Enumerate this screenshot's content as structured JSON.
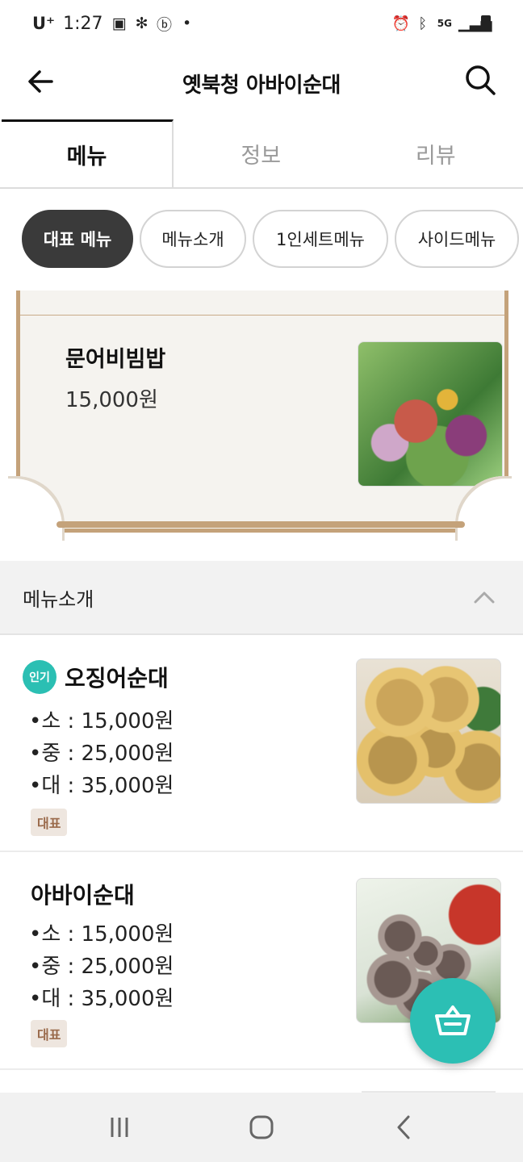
{
  "status_bar": {
    "carrier": "U⁺",
    "time": "1:27",
    "network": "5G"
  },
  "app_bar": {
    "title": "옛북청 아바이순대"
  },
  "tabs": [
    {
      "label": "메뉴",
      "active": true
    },
    {
      "label": "정보",
      "active": false
    },
    {
      "label": "리뷰",
      "active": false
    }
  ],
  "chips": [
    {
      "label": "대표 메뉴",
      "selected": true
    },
    {
      "label": "메뉴소개",
      "selected": false
    },
    {
      "label": "1인세트메뉴",
      "selected": false
    },
    {
      "label": "사이드메뉴",
      "selected": false
    }
  ],
  "featured": {
    "name": "문어비빔밥",
    "price": "15,000원"
  },
  "section": {
    "title": "메뉴소개"
  },
  "menu_items": [
    {
      "badge": "인기",
      "name": "오징어순대",
      "prices": [
        "•소 : 15,000원",
        "•중 : 25,000원",
        "•대 : 35,000원"
      ],
      "tag": "대표"
    },
    {
      "name": "아바이순대",
      "prices": [
        "•소 : 15,000원",
        "•중 : 25,000원",
        "•대 : 35,000원"
      ],
      "tag": "대표"
    }
  ],
  "colors": {
    "accent": "#2cbfb4",
    "chip_selected": "#3a3a3a",
    "frame": "#c4a27a"
  }
}
